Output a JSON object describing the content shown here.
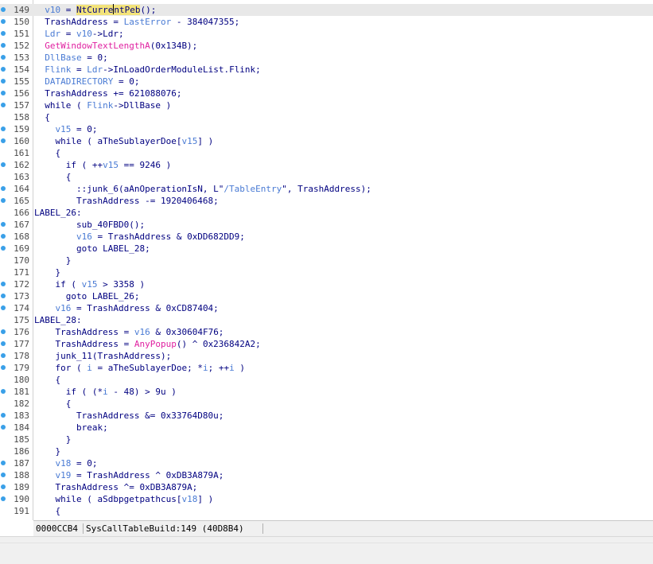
{
  "editor": {
    "lines": [
      {
        "num": "149",
        "dot": true,
        "highlight": true,
        "indent": "  ",
        "tokens": [
          [
            "v",
            "v10"
          ],
          [
            "p",
            " = "
          ],
          [
            "hl",
            "NtCurrentPeb"
          ],
          [
            "p",
            "();"
          ]
        ]
      },
      {
        "num": "150",
        "dot": true,
        "indent": "  ",
        "tokens": [
          [
            "p",
            "TrashAddress = "
          ],
          [
            "v",
            "LastError"
          ],
          [
            "p",
            " - 384047355;"
          ]
        ]
      },
      {
        "num": "151",
        "dot": true,
        "indent": "  ",
        "tokens": [
          [
            "v",
            "Ldr"
          ],
          [
            "p",
            " = "
          ],
          [
            "v",
            "v10"
          ],
          [
            "p",
            "->Ldr;"
          ]
        ]
      },
      {
        "num": "152",
        "dot": true,
        "indent": "  ",
        "tokens": [
          [
            "a",
            "GetWindowTextLengthA"
          ],
          [
            "p",
            "(0x134B);"
          ]
        ]
      },
      {
        "num": "153",
        "dot": true,
        "indent": "  ",
        "tokens": [
          [
            "v",
            "DllBase"
          ],
          [
            "p",
            " = 0;"
          ]
        ]
      },
      {
        "num": "154",
        "dot": true,
        "indent": "  ",
        "tokens": [
          [
            "v",
            "Flink"
          ],
          [
            "p",
            " = "
          ],
          [
            "v",
            "Ldr"
          ],
          [
            "p",
            "->InLoadOrderModuleList.Flink;"
          ]
        ]
      },
      {
        "num": "155",
        "dot": true,
        "indent": "  ",
        "tokens": [
          [
            "v",
            "DATADIRECTORY"
          ],
          [
            "p",
            " = 0;"
          ]
        ]
      },
      {
        "num": "156",
        "dot": true,
        "indent": "  ",
        "tokens": [
          [
            "p",
            "TrashAddress += 621088076;"
          ]
        ]
      },
      {
        "num": "157",
        "dot": true,
        "indent": "  ",
        "tokens": [
          [
            "p",
            "while ( "
          ],
          [
            "v",
            "Flink"
          ],
          [
            "p",
            "->DllBase )"
          ]
        ]
      },
      {
        "num": "158",
        "dot": false,
        "indent": "  ",
        "tokens": [
          [
            "p",
            "{"
          ]
        ]
      },
      {
        "num": "159",
        "dot": true,
        "indent": "    ",
        "tokens": [
          [
            "v",
            "v15"
          ],
          [
            "p",
            " = 0;"
          ]
        ]
      },
      {
        "num": "160",
        "dot": true,
        "indent": "    ",
        "tokens": [
          [
            "p",
            "while ( aTheSublayerDoe["
          ],
          [
            "v",
            "v15"
          ],
          [
            "p",
            "] )"
          ]
        ]
      },
      {
        "num": "161",
        "dot": false,
        "indent": "    ",
        "tokens": [
          [
            "p",
            "{"
          ]
        ]
      },
      {
        "num": "162",
        "dot": true,
        "indent": "      ",
        "tokens": [
          [
            "p",
            "if ( ++"
          ],
          [
            "v",
            "v15"
          ],
          [
            "p",
            " == 9246 )"
          ]
        ]
      },
      {
        "num": "163",
        "dot": false,
        "indent": "      ",
        "tokens": [
          [
            "p",
            "{"
          ]
        ]
      },
      {
        "num": "164",
        "dot": true,
        "indent": "        ",
        "tokens": [
          [
            "p",
            "::junk_6(aAnOperationIsN, L\""
          ],
          [
            "v",
            "/TableEntry"
          ],
          [
            "p",
            "\", TrashAddress);"
          ]
        ]
      },
      {
        "num": "165",
        "dot": true,
        "indent": "        ",
        "tokens": [
          [
            "p",
            "TrashAddress -= 1920406468;"
          ]
        ]
      },
      {
        "num": "166",
        "dot": false,
        "indent": "",
        "tokens": [
          [
            "p",
            "LABEL_26:"
          ]
        ]
      },
      {
        "num": "167",
        "dot": true,
        "indent": "        ",
        "tokens": [
          [
            "p",
            "sub_40FBD0();"
          ]
        ]
      },
      {
        "num": "168",
        "dot": true,
        "indent": "        ",
        "tokens": [
          [
            "v",
            "v16"
          ],
          [
            "p",
            " = TrashAddress & 0xDD682DD9;"
          ]
        ]
      },
      {
        "num": "169",
        "dot": true,
        "indent": "        ",
        "tokens": [
          [
            "p",
            "goto LABEL_28;"
          ]
        ]
      },
      {
        "num": "170",
        "dot": false,
        "indent": "      ",
        "tokens": [
          [
            "p",
            "}"
          ]
        ]
      },
      {
        "num": "171",
        "dot": false,
        "indent": "    ",
        "tokens": [
          [
            "p",
            "}"
          ]
        ]
      },
      {
        "num": "172",
        "dot": true,
        "indent": "    ",
        "tokens": [
          [
            "p",
            "if ( "
          ],
          [
            "v",
            "v15"
          ],
          [
            "p",
            " > 3358 )"
          ]
        ]
      },
      {
        "num": "173",
        "dot": true,
        "indent": "      ",
        "tokens": [
          [
            "p",
            "goto LABEL_26;"
          ]
        ]
      },
      {
        "num": "174",
        "dot": true,
        "indent": "    ",
        "tokens": [
          [
            "v",
            "v16"
          ],
          [
            "p",
            " = TrashAddress & 0xCD87404;"
          ]
        ]
      },
      {
        "num": "175",
        "dot": false,
        "indent": "",
        "tokens": [
          [
            "p",
            "LABEL_28:"
          ]
        ]
      },
      {
        "num": "176",
        "dot": true,
        "indent": "    ",
        "tokens": [
          [
            "p",
            "TrashAddress = "
          ],
          [
            "v",
            "v16"
          ],
          [
            "p",
            " & 0x30604F76;"
          ]
        ]
      },
      {
        "num": "177",
        "dot": true,
        "indent": "    ",
        "tokens": [
          [
            "p",
            "TrashAddress = "
          ],
          [
            "a",
            "AnyPopup"
          ],
          [
            "p",
            "() ^ 0x236842A2;"
          ]
        ]
      },
      {
        "num": "178",
        "dot": true,
        "indent": "    ",
        "tokens": [
          [
            "p",
            "junk_11(TrashAddress);"
          ]
        ]
      },
      {
        "num": "179",
        "dot": true,
        "indent": "    ",
        "tokens": [
          [
            "p",
            "for ( "
          ],
          [
            "v",
            "i"
          ],
          [
            "p",
            " = aTheSublayerDoe; *"
          ],
          [
            "v",
            "i"
          ],
          [
            "p",
            "; ++"
          ],
          [
            "v",
            "i"
          ],
          [
            "p",
            " )"
          ]
        ]
      },
      {
        "num": "180",
        "dot": false,
        "indent": "    ",
        "tokens": [
          [
            "p",
            "{"
          ]
        ]
      },
      {
        "num": "181",
        "dot": true,
        "indent": "      ",
        "tokens": [
          [
            "p",
            "if ( (*"
          ],
          [
            "v",
            "i"
          ],
          [
            "p",
            " - 48) > 9u )"
          ]
        ]
      },
      {
        "num": "182",
        "dot": false,
        "indent": "      ",
        "tokens": [
          [
            "p",
            "{"
          ]
        ]
      },
      {
        "num": "183",
        "dot": true,
        "indent": "        ",
        "tokens": [
          [
            "p",
            "TrashAddress &= 0x33764D80u;"
          ]
        ]
      },
      {
        "num": "184",
        "dot": true,
        "indent": "        ",
        "tokens": [
          [
            "p",
            "break;"
          ]
        ]
      },
      {
        "num": "185",
        "dot": false,
        "indent": "      ",
        "tokens": [
          [
            "p",
            "}"
          ]
        ]
      },
      {
        "num": "186",
        "dot": false,
        "indent": "    ",
        "tokens": [
          [
            "p",
            "}"
          ]
        ]
      },
      {
        "num": "187",
        "dot": true,
        "indent": "    ",
        "tokens": [
          [
            "v",
            "v18"
          ],
          [
            "p",
            " = 0;"
          ]
        ]
      },
      {
        "num": "188",
        "dot": true,
        "indent": "    ",
        "tokens": [
          [
            "v",
            "v19"
          ],
          [
            "p",
            " = TrashAddress ^ 0xDB3A879A;"
          ]
        ]
      },
      {
        "num": "189",
        "dot": true,
        "indent": "    ",
        "tokens": [
          [
            "p",
            "TrashAddress ^= 0xDB3A879A;"
          ]
        ]
      },
      {
        "num": "190",
        "dot": true,
        "indent": "    ",
        "tokens": [
          [
            "p",
            "while ( aSdbpgetpathcus["
          ],
          [
            "v",
            "v18"
          ],
          [
            "p",
            "] )"
          ]
        ]
      },
      {
        "num": "191",
        "dot": false,
        "indent": "    ",
        "tokens": [
          [
            "p",
            "{"
          ]
        ]
      }
    ]
  },
  "status": {
    "offset": "0000CCB4",
    "location": "SysCallTableBuild:149 (40D8B4)"
  },
  "colors": {
    "variable": "#4a7bd4",
    "api_call": "#e020a0",
    "plain": "#000080",
    "breakpoint_dot": "#3aa0e8",
    "current_line": "#e8e8e8",
    "word_highlight": "#f3e37a"
  }
}
